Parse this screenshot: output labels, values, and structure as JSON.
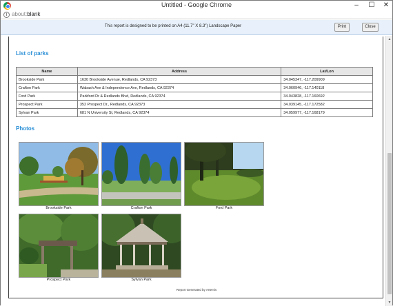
{
  "window": {
    "title": "Untitled - Google Chrome",
    "min_label": "–",
    "max_label": "☐",
    "close_label": "✕"
  },
  "addressbar": {
    "scheme": "about:",
    "url": "blank"
  },
  "print_bar": {
    "notice": "This report is designed to be printed on A4 (11.7\" X 8.3\") Landscape Paper",
    "print_label": "Print",
    "close_label": "Close"
  },
  "report": {
    "parks_title": "List of parks",
    "photos_title": "Photos",
    "footer": "Report Generated by Artemis",
    "table": {
      "headers": [
        "Name",
        "Address",
        "Lat/Lon"
      ],
      "rows": [
        [
          "Brookside Park",
          "1630 Brookside Avenue, Redlands, CA 92373",
          "34.045347, -117.209909"
        ],
        [
          "Crafton Park",
          "Wabash Ave & Independence Ave, Redlands, CA 92374",
          "34.060946, -117.140118"
        ],
        [
          "Ford Park",
          "Parkford Dr & Redlands Blvd, Redlands, CA 92374",
          "34.043828, -117.160692"
        ],
        [
          "Prospect Park",
          "352 Prospect Dr., Redlands, CA 92373",
          "34.039145, -117.172582"
        ],
        [
          "Sylvan Park",
          "681 N University St, Redlands, CA 92374",
          "34.059977, -117.168179"
        ]
      ]
    },
    "photos": [
      {
        "caption": "Brookside Park"
      },
      {
        "caption": "Crafton Park"
      },
      {
        "caption": "Ford Park"
      },
      {
        "caption": "Prospect Park"
      },
      {
        "caption": "Sylvan Park"
      }
    ]
  },
  "colors": {
    "section_title": "#2a8fd6",
    "print_bar_bg": "#e8f1fb"
  },
  "icons": {
    "browser": "chrome-icon",
    "info": "info-icon"
  }
}
